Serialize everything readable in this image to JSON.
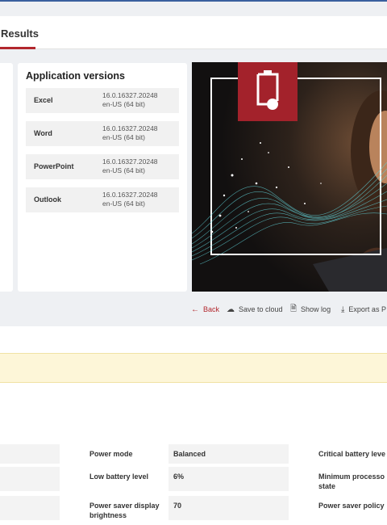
{
  "header": {
    "tab_label": "Results"
  },
  "applications": {
    "title": "Application versions",
    "items": [
      {
        "name": "Excel",
        "version_line1": "16.0.16327.20248",
        "version_line2": "en-US (64 bit)"
      },
      {
        "name": "Word",
        "version_line1": "16.0.16327.20248",
        "version_line2": "en-US (64 bit)"
      },
      {
        "name": "PowerPoint",
        "version_line1": "16.0.16327.20248",
        "version_line2": "en-US (64 bit)"
      },
      {
        "name": "Outlook",
        "version_line1": "16.0.16327.20248",
        "version_line2": "en-US (64 bit)"
      }
    ]
  },
  "hero": {
    "icon": "battery-icon"
  },
  "actions": {
    "back": "Back",
    "save_cloud": "Save to cloud",
    "show_log": "Show log",
    "export": "Export as P"
  },
  "settings": {
    "power_mode_label": "Power mode",
    "power_mode_value": "Balanced",
    "low_battery_label": "Low battery level",
    "low_battery_value": "6%",
    "display_brightness_label_line1": "Power saver display",
    "display_brightness_label_line2": "brightness",
    "display_brightness_value": "70",
    "critical_battery_label": "Critical battery leve",
    "min_processor_label_line1": "Minimum processo",
    "min_processor_label_line2": "state",
    "power_saver_policy_label": "Power saver policy"
  },
  "colors": {
    "accent": "#b2272d",
    "notice_bg": "#fdf6d8",
    "hero_icon_bg": "#a3222b"
  }
}
